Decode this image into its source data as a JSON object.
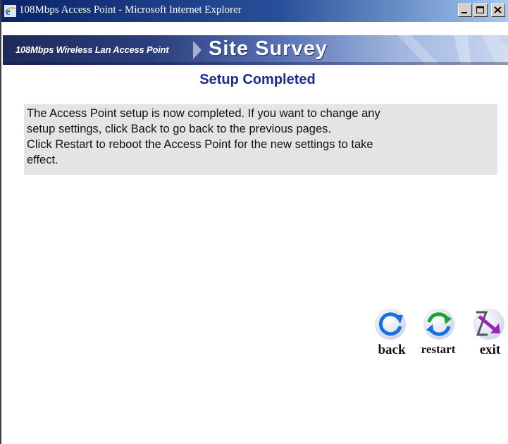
{
  "window": {
    "title": "108Mbps Access Point - Microsoft Internet Explorer",
    "icon": "ie-icon",
    "controls": [
      "minimize-icon",
      "maximize-icon",
      "close-icon"
    ]
  },
  "banner": {
    "subtitle": "108Mbps Wireless Lan Access Point",
    "title": "Site Survey"
  },
  "heading": "Setup Completed",
  "message": {
    "line1": "The Access Point setup is now completed. If you want to change any",
    "line2": "setup settings, click Back to go back to the previous pages.",
    "line3": "Click Restart to reboot the Access Point for the new settings to take",
    "line4": "effect."
  },
  "actions": {
    "back": {
      "label": "back",
      "icon": "back-arrow-icon",
      "color": "#1a6fe0"
    },
    "restart": {
      "label": "restart",
      "icon": "restart-arrows-icon",
      "color": "#1aa332"
    },
    "exit": {
      "label": "exit",
      "icon": "exit-arrow-icon",
      "color": "#a020c0"
    }
  },
  "colors": {
    "heading": "#1c2c8c",
    "message_background": "#e4e4e4",
    "titlebar": "#0a246a"
  }
}
